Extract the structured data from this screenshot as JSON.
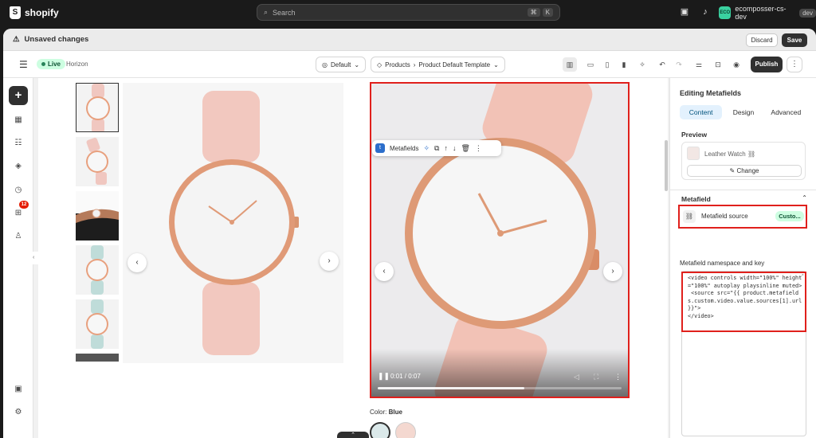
{
  "topbar": {
    "logo_text": "shopify",
    "search_placeholder": "Search",
    "shortcut": [
      "⌘",
      "K"
    ],
    "store_initials": "ECO",
    "store_name": "ecomposser-cs-dev",
    "store_tag": "dev"
  },
  "savebar": {
    "message": "Unsaved changes",
    "discard_label": "Discard",
    "save_label": "Save"
  },
  "toolbar": {
    "status": "Live",
    "theme_name": "Horizon",
    "template_select": "Default",
    "breadcrumb_root": "Products",
    "breadcrumb_template": "Product Default Template",
    "publish_label": "Publish"
  },
  "sidebar": {
    "notification_count": "12"
  },
  "preview": {
    "metafield_toolbar_label": "Metafields",
    "video_time": "0:01 / 0:07",
    "video_progress": 0.6,
    "color_label": "Color:",
    "color_value": "Blue"
  },
  "panel": {
    "title": "Editing Metafields",
    "tabs": [
      {
        "label": "Content",
        "active": true
      },
      {
        "label": "Design",
        "active": false
      },
      {
        "label": "Advanced",
        "active": false
      }
    ],
    "preview_heading": "Preview",
    "preview_product": "Leather Watch",
    "change_label": "Change",
    "metafield_heading": "Metafield",
    "source_label": "Metafield source",
    "source_value": "Custo...",
    "namespace_label": "Metafield namespace and key",
    "code": "<video controls width=\"100%\" height=\"100%\" autoplay playsinline muted>\n <source src=\"{{ product.metafields.custom.video.value.sources[1].url }}\">\n</video>"
  },
  "colors": {
    "accent": "#e0201c",
    "live_badge_bg": "#cdfee1",
    "active_tab_bg": "#e3f1fd",
    "dark": "#303030"
  }
}
